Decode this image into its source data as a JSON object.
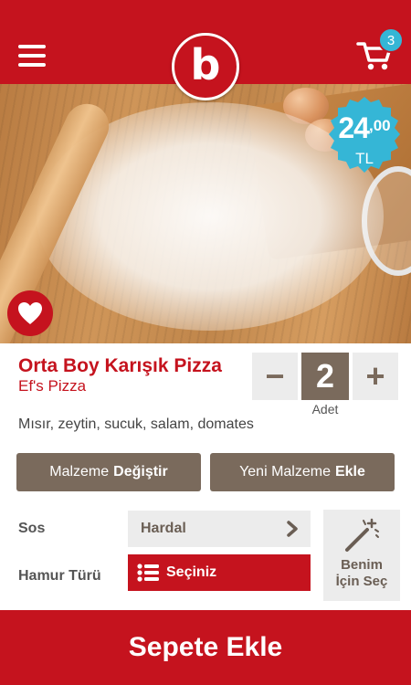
{
  "header": {
    "logo_letter": "b",
    "cart_count": "3"
  },
  "product": {
    "price_main": "24",
    "price_cents": ",00",
    "currency": "TL",
    "title": "Orta Boy Karışık Pizza",
    "restaurant": "Ef's Pizza",
    "description": "Mısır, zeytin, sucuk, salam, domates"
  },
  "quantity": {
    "minus": "−",
    "value": "2",
    "plus": "+",
    "label": "Adet"
  },
  "actions": {
    "change_prefix": "Malzeme",
    "change_bold": "Değiştir",
    "add_prefix": "Yeni Malzeme",
    "add_bold": "Ekle"
  },
  "options": {
    "sauce_label": "Sos",
    "sauce_value": "Hardal",
    "dough_label": "Hamur Türü",
    "dough_value": "Seçiniz",
    "auto_line1": "Benim",
    "auto_line2": "İçin Seç"
  },
  "footer": {
    "add_to_cart": "Sepete Ekle"
  },
  "colors": {
    "brand_red": "#c5131e",
    "brown": "#7a6a5c",
    "badge_blue": "#35b6d6"
  },
  "icons": [
    "menu-icon",
    "cart-icon",
    "heart-icon",
    "chevron-right-icon",
    "list-icon",
    "magic-wand-icon"
  ]
}
